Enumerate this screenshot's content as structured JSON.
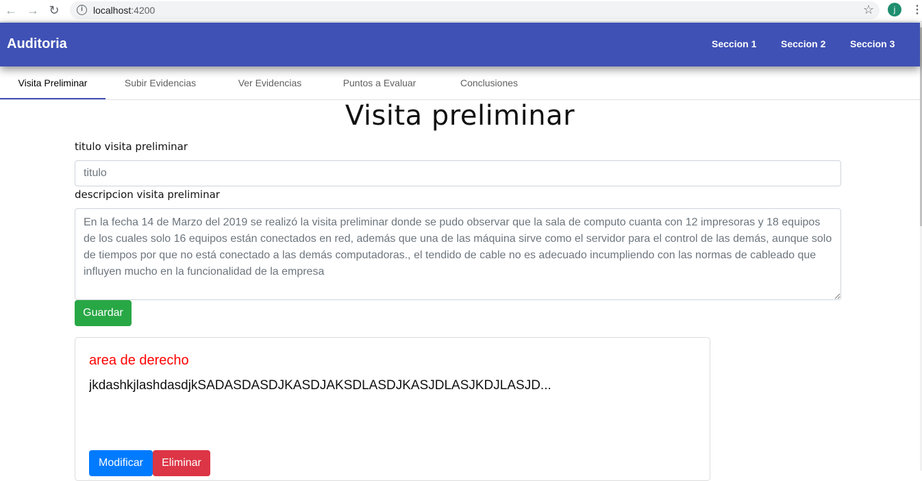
{
  "browser": {
    "url_host": "localhost",
    "url_port": ":4200",
    "profile_initial": "j"
  },
  "navbar": {
    "brand": "Auditoria",
    "links": [
      "Seccion 1",
      "Seccion 2",
      "Seccion 3"
    ],
    "color": "#3f51b5"
  },
  "tabs": [
    {
      "label": "Visita Preliminar",
      "active": true
    },
    {
      "label": "Subir Evidencias",
      "active": false
    },
    {
      "label": "Ver Evidencias",
      "active": false
    },
    {
      "label": "Puntos a Evaluar",
      "active": false
    },
    {
      "label": "Conclusiones",
      "active": false
    }
  ],
  "form": {
    "page_title": "Visita preliminar",
    "title_label": "titulo visita preliminar",
    "title_placeholder": "titulo",
    "description_label": "descripcion visita preliminar",
    "description_value": "En la fecha 14 de Marzo del 2019 se realizó la visita preliminar donde se pudo observar que la sala de computo cuanta con 12 impresoras y 18 equipos de los cuales solo 16 equipos están conectados en red, además que una de las máquina sirve como el servidor para el control de las demás, aunque solo de tiempos por que no está conectado a las demás computadoras., el tendido de cable no es adecuado incumpliendo con las normas de cableado que influyen mucho en la funcionalidad de la empresa",
    "save_label": "Guardar"
  },
  "card": {
    "title": "area de derecho",
    "text": "jkdashkjlashdasdjkSADASDASDJKASDJAKSDLASDJKASJDLASJKDJLASJD...",
    "modify_label": "Modificar",
    "delete_label": "Eliminar"
  }
}
